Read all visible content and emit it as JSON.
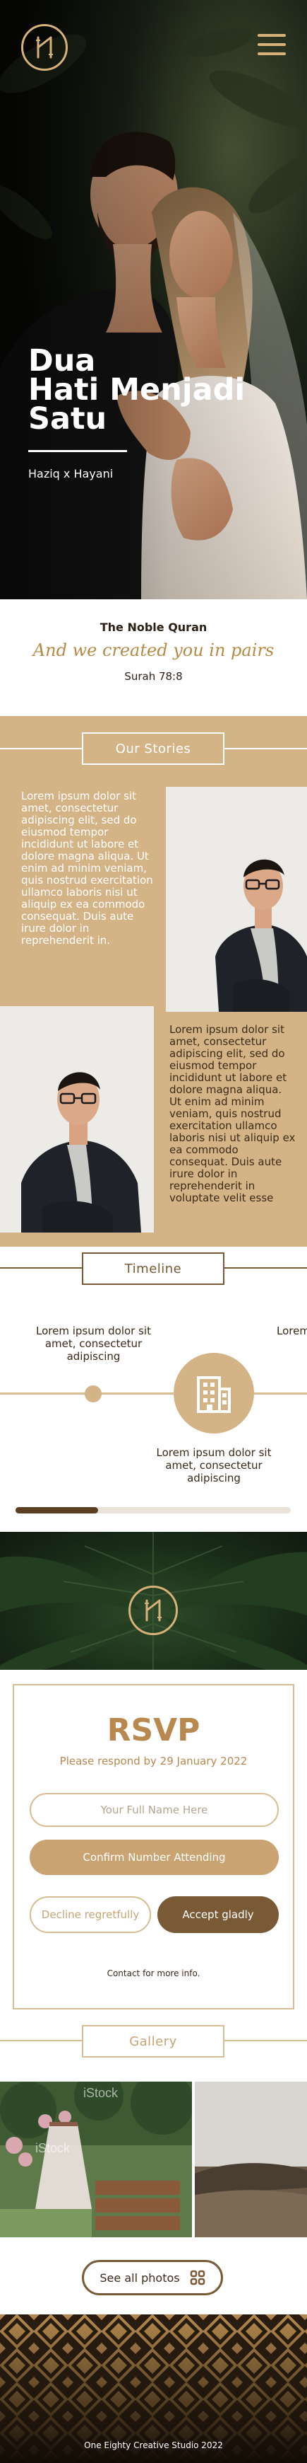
{
  "hero": {
    "title_line1": "Dua",
    "title_line2": "Hati Menjadi",
    "title_line3": "Satu",
    "names": "Haziq x Hayani",
    "logo_icon": "monogram-icon",
    "menu_icon": "hamburger-menu-icon"
  },
  "quran": {
    "title": "The Noble Quran",
    "verse": "And we created you in pairs",
    "reference": "Surah 78:8"
  },
  "stories": {
    "heading": "Our Stories",
    "paragraph1": "Lorem ipsum dolor sit amet, consectetur adipiscing elit, sed do eiusmod tempor incididunt ut labore et dolore magna aliqua. Ut enim ad minim veniam, quis nostrud exercitation ullamco laboris nisi ut aliquip ex ea commodo consequat. Duis aute irure dolor in reprehenderit in.",
    "paragraph2": "Lorem ipsum dolor sit amet, consectetur adipiscing elit, sed do eiusmod tempor incididunt ut labore et dolore magna aliqua. Ut enim ad minim veniam, quis nostrud exercitation ullamco laboris nisi ut aliquip ex ea commodo consequat. Duis aute irure dolor in reprehenderit in voluptate velit esse"
  },
  "timeline": {
    "heading": "Timeline",
    "top_left": "Lorem ipsum dolor sit amet, consectetur adipiscing",
    "top_right_partial": "Lorem",
    "bottom_center": "Lorem ipsum dolor sit amet, consectetur adipiscing",
    "center_icon": "building-icon",
    "progress": 0.3
  },
  "rsvp": {
    "title": "RSVP",
    "subtitle": "Please respond by 29 January 2022",
    "name_placeholder": "Your Full Name Here",
    "confirm_label": "Confirm Number Attending",
    "decline_label": "Decline regretfully",
    "accept_label": "Accept gladly",
    "contact_label": "Contact for more info."
  },
  "gallery": {
    "heading": "Gallery",
    "watermark": "iStock",
    "see_all_label": "See all photos",
    "see_all_icon": "grid-icon"
  },
  "footer": {
    "credit": "One Eighty Creative Studio 2022"
  },
  "colors": {
    "gold": "#d4b487",
    "dark_gold": "#b8884f",
    "brown": "#7a5a36",
    "dark_brown": "#2a1d10"
  }
}
